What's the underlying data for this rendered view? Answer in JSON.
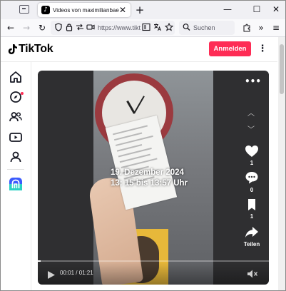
{
  "browser": {
    "tab_title": "Videos von maximilianbaehring",
    "tab_close": "✕",
    "new_tab": "+",
    "url_text": "https://www.tiktok",
    "search_placeholder": "Suchen",
    "window_controls": {
      "minimize": "—",
      "maximize": "☐",
      "close": "✕"
    },
    "nav": {
      "back": "←",
      "forward": "→",
      "reload": "↻",
      "overflow": "»",
      "menu": "≡"
    }
  },
  "tiktok": {
    "logo_text": "TikTok",
    "login_label": "Anmelden",
    "more": "⋮"
  },
  "sidebar": {
    "items": [
      {
        "icon": "home-icon"
      },
      {
        "icon": "explore-icon",
        "notification": true
      },
      {
        "icon": "following-icon"
      },
      {
        "icon": "live-icon"
      },
      {
        "icon": "profile-icon"
      },
      {
        "icon": "app-icon"
      }
    ]
  },
  "video": {
    "overlay_line1": "19. Dezember 2024",
    "overlay_line2": "13: 15 bis 13:57 Uhr",
    "menu": "•••",
    "prev": "︿",
    "next": "﹀",
    "likes": "1",
    "comments": "0",
    "saves": "1",
    "share_label": "Teilen",
    "time": "00:01 / 01:21",
    "progress_fraction": 0.012
  },
  "colors": {
    "accent": "#fe2c55",
    "video_bg": "#2f2f31"
  }
}
